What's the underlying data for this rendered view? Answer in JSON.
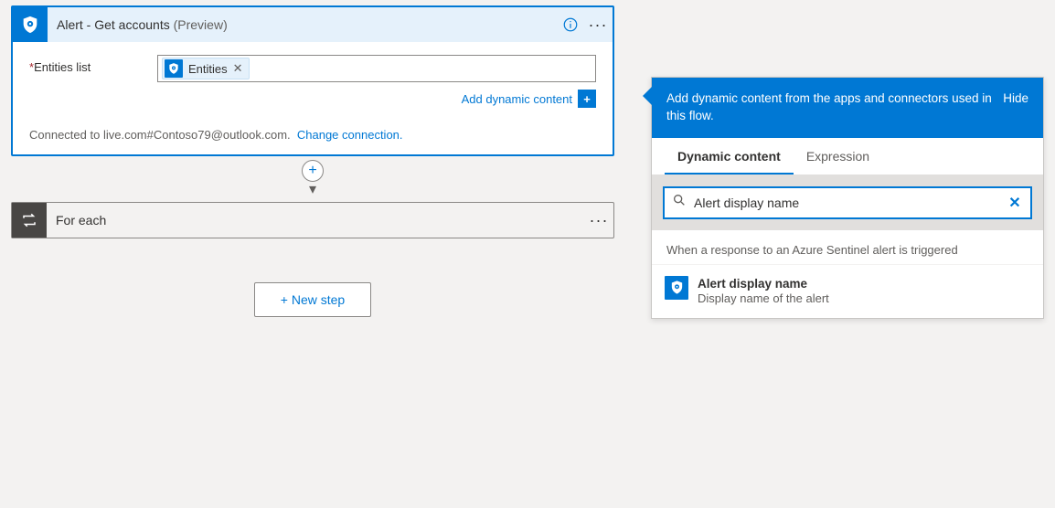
{
  "alertCard": {
    "title": "Alert - Get accounts",
    "preview": "(Preview)",
    "field_label": "Entities list",
    "token_label": "Entities",
    "add_dc_label": "Add dynamic content",
    "connected_text": "Connected to live.com#Contoso79@outlook.com.",
    "change_conn": "Change connection."
  },
  "foreach": {
    "title": "For each"
  },
  "new_step": {
    "label": "+ New step"
  },
  "dc": {
    "header": "Add dynamic content from the apps and connectors used in this flow.",
    "hide": "Hide",
    "tabs": {
      "dynamic": "Dynamic content",
      "expression": "Expression"
    },
    "search_value": "Alert display name",
    "group": "When a response to an Azure Sentinel alert is triggered",
    "item": {
      "title": "Alert display name",
      "subtitle": "Display name of the alert"
    }
  }
}
